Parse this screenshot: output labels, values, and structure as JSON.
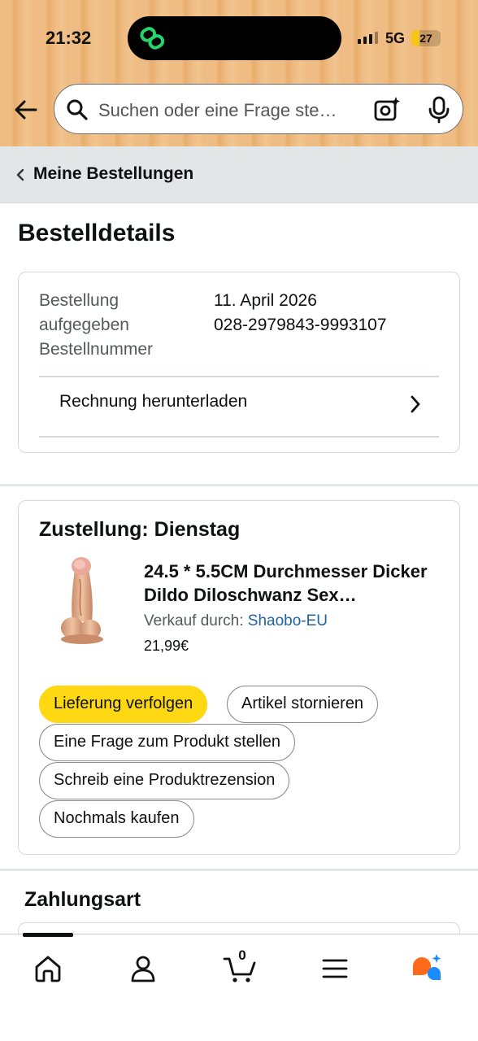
{
  "status_bar": {
    "time": "21:32",
    "network": "5G",
    "battery": "27",
    "battery_level": 0.27
  },
  "search": {
    "placeholder": "Suchen oder eine Frage ste…"
  },
  "breadcrumb": {
    "label": "Meine Bestellungen"
  },
  "page": {
    "title": "Bestelldetails"
  },
  "order": {
    "labels": [
      "Bestellung",
      "aufgegeben",
      "Bestellnummer"
    ],
    "date": "11. April 2026",
    "number": "028-2979843-9993107",
    "invoice_label": "Rechnung herunterladen"
  },
  "shipment": {
    "title": "Zustellung: Dienstag",
    "product": {
      "title": "24.5 * 5.5CM Durchmesser Dicker Dildo Diloschwanz Sex…",
      "seller_prefix": "Verkauf durch: ",
      "seller_name": "Shaobo-EU",
      "price": "21,99€"
    },
    "buttons": {
      "track": "Lieferung verfolgen",
      "cancel": "Artikel stornieren",
      "question": "Eine Frage zum Produkt stellen",
      "review": "Schreib eine Produktrezension",
      "buy_again": "Nochmals kaufen"
    }
  },
  "payment": {
    "title": "Zahlungsart"
  },
  "bottom_nav": {
    "cart_count": "0",
    "items": [
      "home-icon",
      "account-icon",
      "cart-icon",
      "menu-icon",
      "rufus-icon"
    ]
  },
  "colors": {
    "header": "#efbc83",
    "primary_button": "#ffd814",
    "link": "#2162a1"
  }
}
